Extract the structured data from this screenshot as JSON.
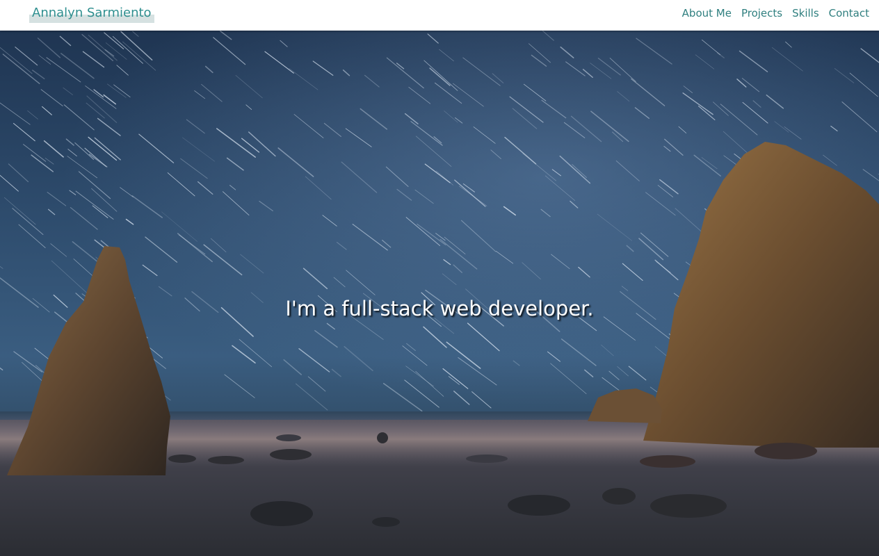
{
  "header": {
    "brand": "Annalyn Sarmiento",
    "nav": [
      {
        "label": "About Me"
      },
      {
        "label": "Projects"
      },
      {
        "label": "Skills"
      },
      {
        "label": "Contact"
      }
    ]
  },
  "hero": {
    "tagline": "I'm a full-stack web developer.",
    "image_subject": "star trails over sea stacks on a misty beach at night"
  },
  "colors": {
    "brand_text": "#2f8f8f",
    "nav_text": "#2f7f7f",
    "navbar_bg": "#ffffff"
  }
}
